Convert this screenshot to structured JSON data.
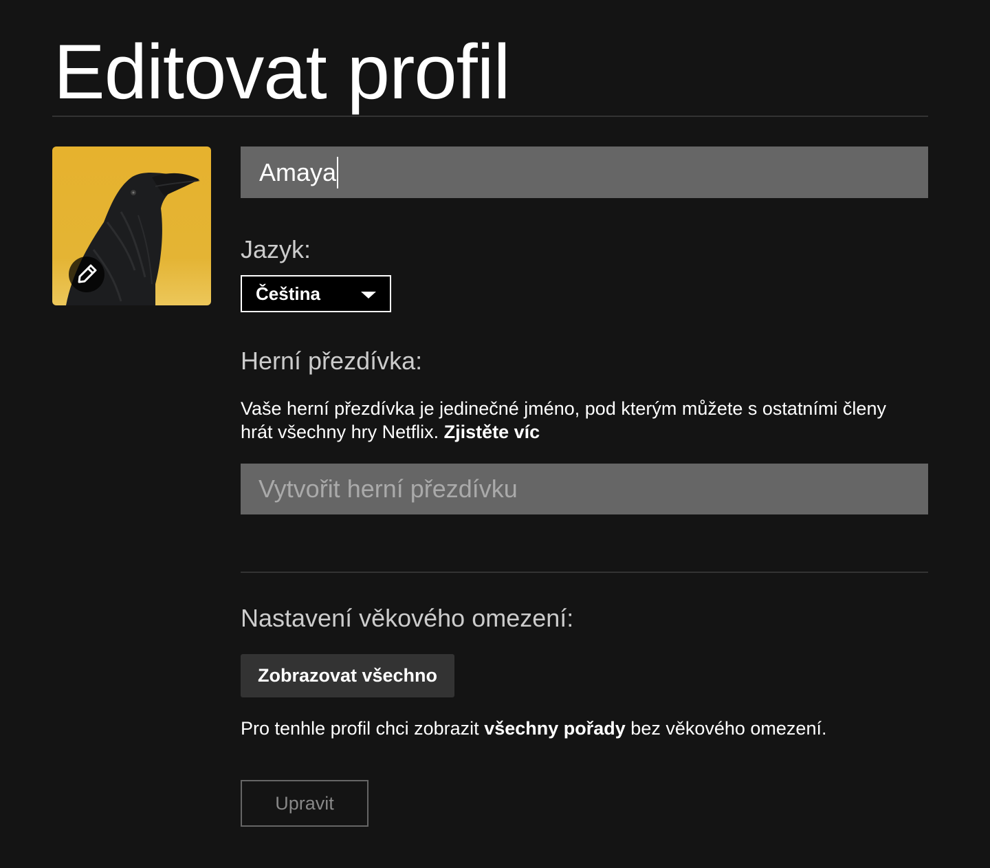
{
  "page": {
    "title": "Editovat profil"
  },
  "profile": {
    "avatar_icon": "raven-avatar-icon",
    "edit_icon": "pencil-icon",
    "name_value": "Amaya"
  },
  "language": {
    "label": "Jazyk:",
    "selected": "Čeština"
  },
  "gamer_handle": {
    "label": "Herní přezdívka:",
    "description": "Vaše herní přezdívka je jedinečné jméno, pod kterým můžete s ostatními členy hrát všechny hry Netflix.",
    "learn_more": "Zjistěte víc",
    "placeholder": "Vytvořit herní přezdívku"
  },
  "maturity": {
    "label": "Nastavení věkového omezení:",
    "badge": "Zobrazovat všechno",
    "desc_prefix": "Pro tenhle profil chci zobrazit",
    "desc_bold": "všechny pořady",
    "desc_suffix": "bez věkového omezení.",
    "edit_button": "Upravit"
  },
  "colors": {
    "background": "#141414",
    "input_bg": "#666666",
    "avatar_bg": "#e6b22e"
  }
}
